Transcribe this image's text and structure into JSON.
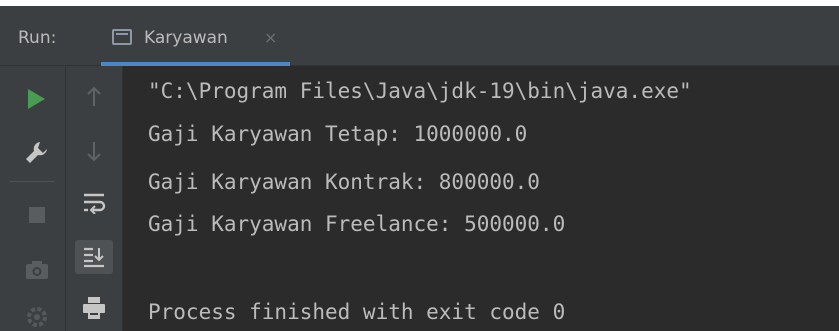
{
  "header": {
    "run_label": "Run:",
    "tab_label": "Karyawan",
    "tab_close": "×"
  },
  "toolbar": {
    "left": [
      "play-icon",
      "wrench-icon",
      "stop-icon",
      "camera-icon",
      "gear-icon"
    ],
    "right": [
      "arrow-up-icon",
      "arrow-down-icon",
      "soft-wrap-icon",
      "scroll-to-end-icon",
      "print-icon"
    ]
  },
  "console": {
    "lines": [
      "\"C:\\Program Files\\Java\\jdk-19\\bin\\java.exe\"",
      "Gaji Karyawan Tetap: 1000000.0",
      "Gaji Karyawan Kontrak: 800000.0",
      "Gaji Karyawan Freelance: 500000.0",
      "",
      "Process finished with exit code 0"
    ]
  },
  "colors": {
    "background": "#2b2b2b",
    "panel": "#3c3f41",
    "text": "#bbbbbb",
    "accent": "#4a88c7",
    "run_green": "#499c54"
  }
}
